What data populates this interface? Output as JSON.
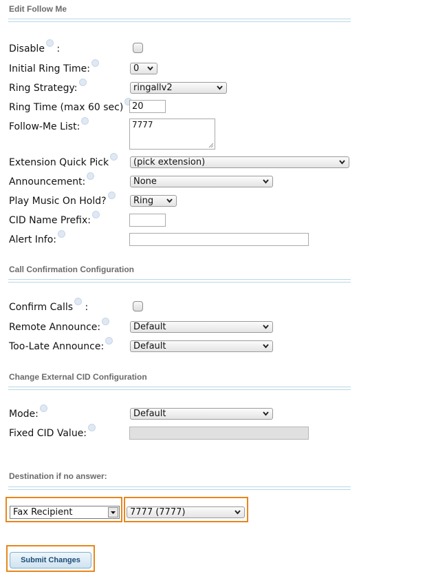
{
  "sections": {
    "edit_follow_me": "Edit Follow Me",
    "call_confirmation": "Call Confirmation Configuration",
    "external_cid": "Change External CID Configuration",
    "destination": "Destination if no answer:"
  },
  "fields": {
    "disable": {
      "label": "Disable",
      "suffix": ":"
    },
    "initial_ring_time": {
      "label": "Initial Ring Time:",
      "value": "0"
    },
    "ring_strategy": {
      "label": "Ring Strategy:",
      "value": "ringallv2"
    },
    "ring_time": {
      "label": "Ring Time (max 60 sec)",
      "value": "20"
    },
    "follow_me_list": {
      "label": "Follow-Me List:",
      "value": "7777"
    },
    "extension_quick_pick": {
      "label": "Extension Quick Pick",
      "value": "(pick extension)"
    },
    "announcement": {
      "label": "Announcement:",
      "value": "None"
    },
    "play_moh": {
      "label": "Play Music On Hold?",
      "value": "Ring"
    },
    "cid_name_prefix": {
      "label": "CID Name Prefix:",
      "value": ""
    },
    "alert_info": {
      "label": "Alert Info:",
      "value": ""
    },
    "confirm_calls": {
      "label": "Confirm Calls",
      "suffix": ":"
    },
    "remote_announce": {
      "label": "Remote Announce:",
      "value": "Default"
    },
    "too_late_announce": {
      "label": "Too-Late Announce:",
      "value": "Default"
    },
    "mode": {
      "label": "Mode:",
      "value": "Default"
    },
    "fixed_cid_value": {
      "label": "Fixed CID Value:",
      "value": ""
    }
  },
  "destination": {
    "type": "Fax Recipient",
    "target": "7777 (7777)"
  },
  "submit_label": "Submit Changes",
  "colors": {
    "highlight": "#e8861a",
    "rule": "#b9d6e6",
    "button_text": "#1b4c78"
  },
  "icons": [
    "help-icon",
    "chevron-down-icon",
    "resize-grip-icon"
  ]
}
